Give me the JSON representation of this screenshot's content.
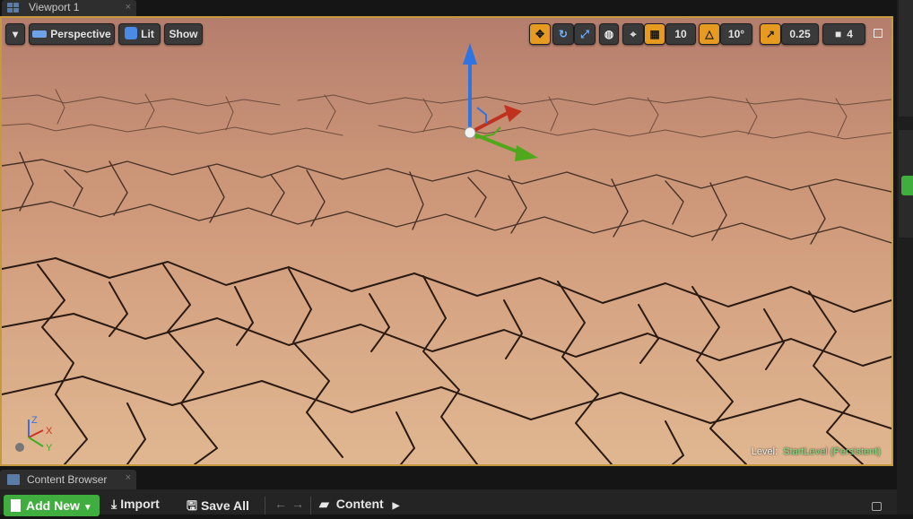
{
  "viewport_tab": {
    "label": "Viewport 1",
    "close": "×"
  },
  "toolbar": {
    "options_arrow": "▾",
    "perspective": "Perspective",
    "lit": "Lit",
    "show": "Show",
    "grid_snap": "10",
    "rotation_snap": "10°",
    "scale_snap": "0.25",
    "camera_speed": "4"
  },
  "level": {
    "prefix": "Level:",
    "name": "StartLevel (Persistent)"
  },
  "axis_labels": {
    "x": "X",
    "y": "Y",
    "z": "Z"
  },
  "content_browser_tab": {
    "label": "Content Browser",
    "close": "×"
  },
  "content_toolbar": {
    "add_new": "Add New",
    "import": "Import",
    "save_all": "Save All",
    "path": "Content"
  },
  "colors": {
    "accent": "#e69a1f",
    "viewport_border": "#c59a3c",
    "add_new": "#3fae3f",
    "level_name": "#7ee27e"
  }
}
